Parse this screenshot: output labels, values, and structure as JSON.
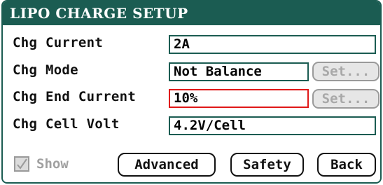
{
  "window": {
    "title": "LIPO CHARGE SETUP"
  },
  "rows": [
    {
      "label": "Chg Current",
      "value": "2A"
    },
    {
      "label": "Chg Mode",
      "value": "Not Balance",
      "set_label": "Set..."
    },
    {
      "label": "Chg End Current",
      "value": "10%",
      "set_label": "Set...",
      "selected": true
    },
    {
      "label": "Chg Cell Volt",
      "value": "4.2V/Cell"
    }
  ],
  "footer": {
    "show": {
      "label": "Show",
      "checked": true,
      "enabled": false
    },
    "advanced_label": "Advanced",
    "safety_label": "Safety",
    "back_label": "Back"
  },
  "colors": {
    "accent": "#1b5c52",
    "selection": "#e01818",
    "disabled": "#a0a0a0"
  }
}
